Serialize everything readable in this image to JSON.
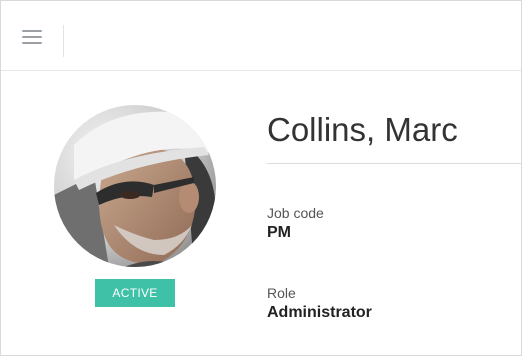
{
  "toolbar": {
    "menu_icon": "hamburger-menu-icon"
  },
  "profile": {
    "name": "Collins, Marc",
    "status": "ACTIVE",
    "status_color": "#3fc1a7",
    "avatar_description": "photo"
  },
  "fields": [
    {
      "label": "Job code",
      "value": "PM"
    },
    {
      "label": "Role",
      "value": "Administrator"
    }
  ]
}
